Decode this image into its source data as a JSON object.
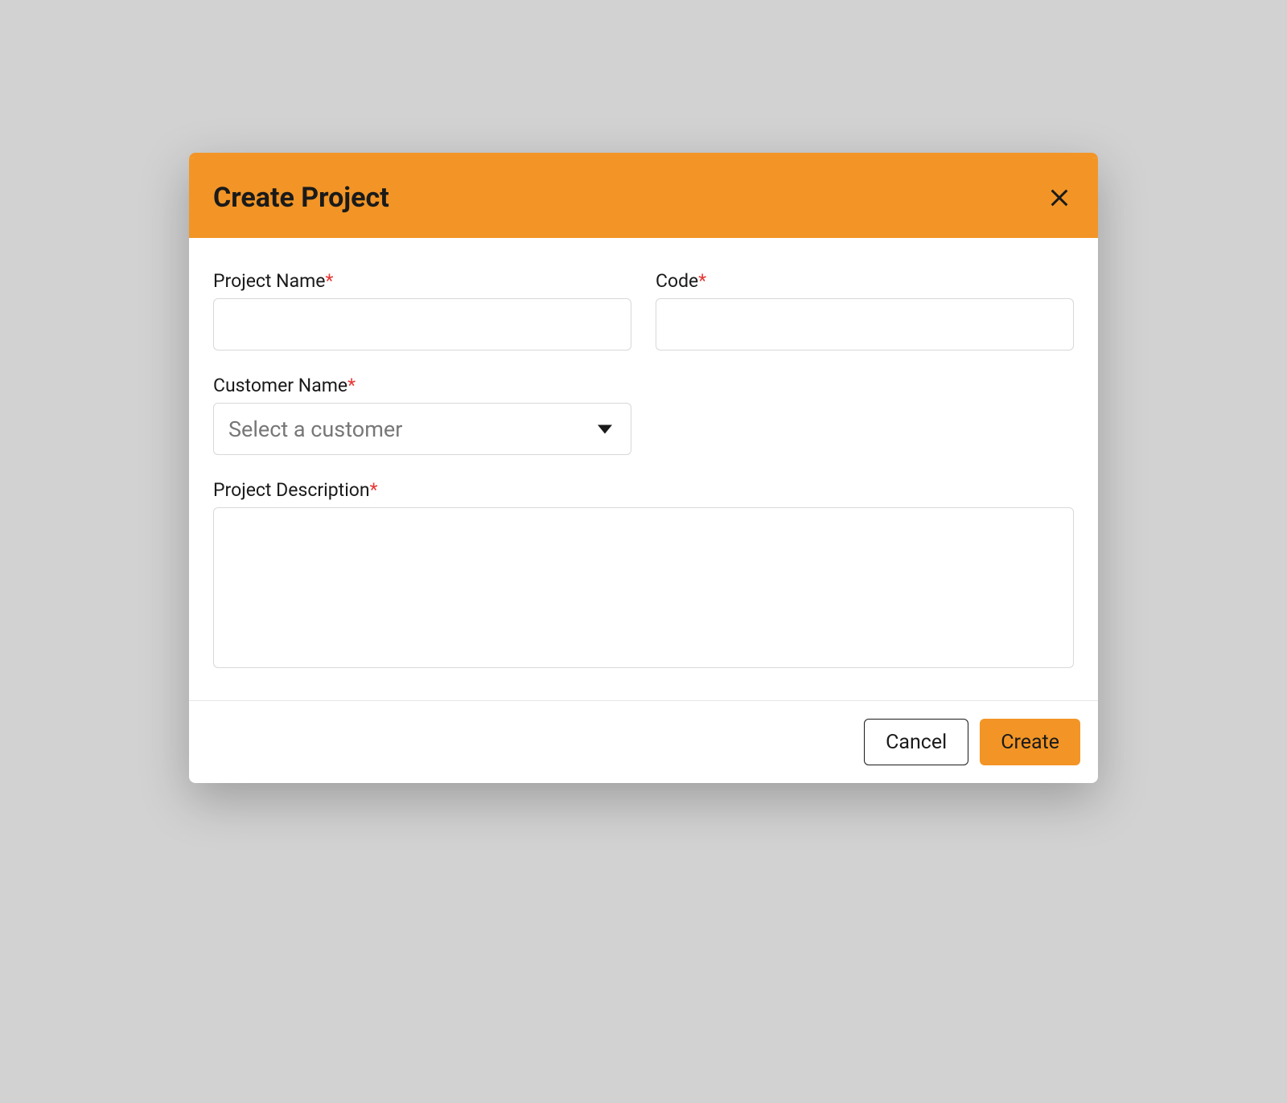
{
  "modal": {
    "title": "Create Project",
    "fields": {
      "projectName": {
        "label": "Project Name",
        "value": ""
      },
      "code": {
        "label": "Code",
        "value": ""
      },
      "customerName": {
        "label": "Customer Name",
        "placeholder": "Select a customer",
        "value": ""
      },
      "projectDescription": {
        "label": "Project Description",
        "value": ""
      }
    },
    "requiredMark": "*",
    "footer": {
      "cancel": "Cancel",
      "create": "Create"
    }
  },
  "colors": {
    "accent": "#f29526",
    "requiredMark": "#e53935"
  }
}
